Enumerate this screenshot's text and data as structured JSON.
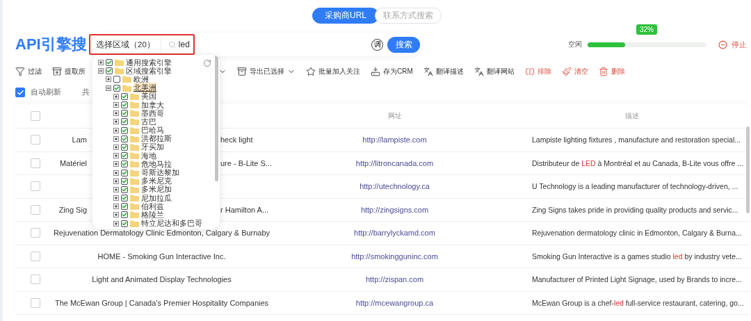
{
  "mode_tabs": [
    {
      "label": "采购商URL",
      "selected": true
    },
    {
      "label": "联系方式搜索",
      "selected": false
    }
  ],
  "title": "API引擎搜",
  "search": {
    "region_label": "选择区域（20）",
    "query": "led",
    "lookup_label": "调",
    "button": "搜索"
  },
  "progress": {
    "label": "空闲",
    "level": 0.32,
    "reading": "32%",
    "stop": "停止"
  },
  "toolbar": [
    {
      "label": "过滤",
      "kind": "action"
    },
    {
      "label": "提取所",
      "kind": "cut"
    },
    {
      "label": "导出已选择",
      "kind": "menu"
    },
    {
      "label": "批量加入关注",
      "kind": "action"
    },
    {
      "label": "存为CRM",
      "kind": "action"
    },
    {
      "label": "翻译描述",
      "kind": "action"
    },
    {
      "label": "翻译网站",
      "kind": "action"
    },
    {
      "label": "排除",
      "kind": "danger"
    },
    {
      "label": "清空",
      "kind": "danger"
    },
    {
      "label": "删除",
      "kind": "danger"
    }
  ],
  "auto_refresh": {
    "label": "自动刷新",
    "checked": true
  },
  "found_label": "共",
  "region_tree": [
    {
      "label": "通用搜索引擎",
      "checked": true,
      "expanded": false,
      "selected": false
    },
    {
      "label": "区域搜索引擎",
      "checked": true,
      "expanded": true,
      "selected": false,
      "children": [
        {
          "label": "欧洲",
          "checked": false,
          "expanded": false,
          "selected": false
        },
        {
          "label": "北美洲",
          "checked": true,
          "expanded": true,
          "selected": true,
          "children": [
            {
              "label": "美国",
              "checked": true,
              "expanded": false,
              "selected": false
            },
            {
              "label": "加拿大",
              "checked": true,
              "expanded": false,
              "selected": false
            },
            {
              "label": "墨西哥",
              "checked": true,
              "expanded": false,
              "selected": false
            },
            {
              "label": "古巴",
              "checked": true,
              "expanded": false,
              "selected": false
            },
            {
              "label": "巴哈马",
              "checked": true,
              "expanded": false,
              "selected": false
            },
            {
              "label": "洪都拉斯",
              "checked": true,
              "expanded": false,
              "selected": false
            },
            {
              "label": "牙买加",
              "checked": true,
              "expanded": false,
              "selected": false
            },
            {
              "label": "海地",
              "checked": true,
              "expanded": false,
              "selected": false
            },
            {
              "label": "危地马拉",
              "checked": true,
              "expanded": false,
              "selected": false
            },
            {
              "label": "哥斯达黎加",
              "checked": true,
              "expanded": false,
              "selected": false
            },
            {
              "label": "多米尼克",
              "checked": true,
              "expanded": false,
              "selected": false
            },
            {
              "label": "多米尼加",
              "checked": true,
              "expanded": false,
              "selected": false
            },
            {
              "label": "尼加拉瓜",
              "checked": true,
              "expanded": false,
              "selected": false
            },
            {
              "label": "伯利兹",
              "checked": true,
              "expanded": false,
              "selected": false
            },
            {
              "label": "格陵兰",
              "checked": true,
              "expanded": false,
              "selected": false
            },
            {
              "label": "特立尼达和多巴哥",
              "checked": true,
              "expanded": false,
              "selected": false
            }
          ]
        }
      ]
    }
  ],
  "table": {
    "columns": [
      "网址",
      "描述"
    ],
    "header_selected": false,
    "rows": [
      {
        "selected": false,
        "title_left": "Lam",
        "title_right": "heck light",
        "url": "http://lampiste.com",
        "description": [
          {
            "text": "Lampiste lighting fixtures , manufacture and restoration special...",
            "highlight": false
          }
        ]
      },
      {
        "selected": false,
        "title_left": "Matériel",
        "title_right": "ure - B-Lite S...",
        "url": "http://litroncanada.com",
        "description": [
          {
            "text": "Distributeur de ",
            "highlight": false
          },
          {
            "text": "LED",
            "highlight": true
          },
          {
            "text": " à Montréal et au Canada, B-Lite vous offre ...",
            "highlight": false
          }
        ]
      },
      {
        "selected": false,
        "url": "http://utechnology.ca",
        "description": [
          {
            "text": "U Technology is a leading manufacturer of technology-driven, ...",
            "highlight": false
          }
        ]
      },
      {
        "selected": false,
        "title_left": "Zing Sig",
        "title_right": "r Hamilton A...",
        "url": "http://zingsigns.com",
        "description": [
          {
            "text": "Zing Signs takes pride in providing quality products and servic...",
            "highlight": false
          }
        ]
      },
      {
        "selected": false,
        "title": "Rejuvenation Dermatology Clinic Edmonton, Calgary & Burnaby",
        "url": "http://barrylyckamd.com",
        "description": [
          {
            "text": "Rejuvenation dermatology clinic in Edmonton, Calgary & Burna...",
            "highlight": false
          }
        ]
      },
      {
        "selected": false,
        "title": "HOME - Smoking Gun Interactive Inc.",
        "url": "http://smokingguninc.com",
        "description": [
          {
            "text": "Smoking Gun Interactive is a games studio ",
            "highlight": false
          },
          {
            "text": "led",
            "highlight": true
          },
          {
            "text": " by industry vete...",
            "highlight": false
          }
        ]
      },
      {
        "selected": false,
        "title": "Light and Animated Display Technologies",
        "url": "http://zispan.com",
        "description": [
          {
            "text": "Manufacturer of Printed Light Signage, used by Brands to incre...",
            "highlight": false
          }
        ]
      },
      {
        "selected": false,
        "title": "The McEwan Group | Canada’s Premier Hospitality Companies",
        "url": "http://mcewangroup.ca",
        "description": [
          {
            "text": "McEwan Group is a chef-",
            "highlight": false
          },
          {
            "text": "led",
            "highlight": true
          },
          {
            "text": " full-service restaurant, catering, go...",
            "highlight": false
          }
        ]
      }
    ]
  }
}
